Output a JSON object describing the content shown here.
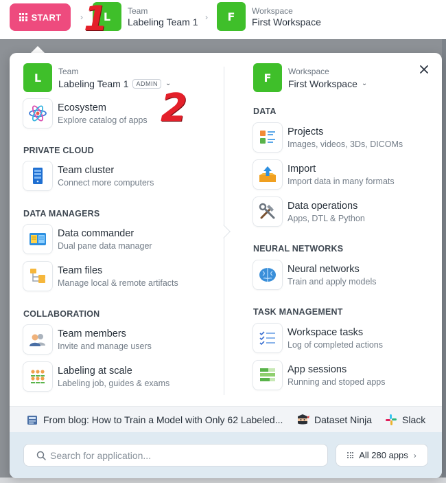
{
  "topbar": {
    "start_label": "START",
    "team": {
      "avatar": "L",
      "caption": "Team",
      "name": "Labeling Team 1"
    },
    "workspace": {
      "avatar": "F",
      "caption": "Workspace",
      "name": "First Workspace"
    },
    "annotation_1": "1",
    "annotation_2": "2"
  },
  "panel": {
    "team": {
      "avatar": "L",
      "caption": "Team",
      "name": "Labeling Team 1",
      "badge": "ADMIN"
    },
    "workspace": {
      "avatar": "F",
      "caption": "Workspace",
      "name": "First Workspace"
    },
    "ecosystem": {
      "title": "Ecosystem",
      "subtitle": "Explore catalog of apps",
      "icon": "atom-icon"
    },
    "left_sections": [
      {
        "title": "PRIVATE CLOUD",
        "items": [
          {
            "title": "Team cluster",
            "subtitle": "Connect more computers",
            "icon": "server-icon"
          }
        ]
      },
      {
        "title": "DATA MANAGERS",
        "items": [
          {
            "title": "Data commander",
            "subtitle": "Dual pane data manager",
            "icon": "dual-pane-icon"
          },
          {
            "title": "Team files",
            "subtitle": "Manage local & remote artifacts",
            "icon": "folder-tree-icon"
          }
        ]
      },
      {
        "title": "COLLABORATION",
        "items": [
          {
            "title": "Team members",
            "subtitle": "Invite and manage users",
            "icon": "users-icon"
          },
          {
            "title": "Labeling at scale",
            "subtitle": "Labeling job, guides & exams",
            "icon": "group-icon"
          }
        ]
      }
    ],
    "right_sections": [
      {
        "title": "DATA",
        "items": [
          {
            "title": "Projects",
            "subtitle": "Images, videos, 3Ds, DICOMs",
            "icon": "projects-icon"
          },
          {
            "title": "Import",
            "subtitle": "Import data in many formats",
            "icon": "import-icon"
          },
          {
            "title": "Data operations",
            "subtitle": "Apps, DTL & Python",
            "icon": "tools-icon"
          }
        ]
      },
      {
        "title": "NEURAL NETWORKS",
        "items": [
          {
            "title": "Neural networks",
            "subtitle": "Train and apply models",
            "icon": "brain-icon"
          }
        ]
      },
      {
        "title": "TASK MANAGEMENT",
        "items": [
          {
            "title": "Workspace tasks",
            "subtitle": "Log of completed actions",
            "icon": "checklist-icon"
          },
          {
            "title": "App sessions",
            "subtitle": "Running and stoped apps",
            "icon": "sessions-icon"
          }
        ]
      }
    ],
    "blog": {
      "label": "From blog: How to Train a Model with Only 62 Labeled...",
      "icon": "newspaper-icon"
    },
    "ninja": {
      "label": "Dataset Ninja",
      "icon": "ninja-icon"
    },
    "slack": {
      "label": "Slack",
      "icon": "slack-icon"
    },
    "search": {
      "placeholder": "Search for application..."
    },
    "all_apps": {
      "label": "All 280 apps"
    }
  },
  "colors": {
    "start": "#ee4b7e",
    "avatar": "#3fbf2a",
    "annotation": "#e4202a",
    "footer": "#dfeaf2"
  }
}
